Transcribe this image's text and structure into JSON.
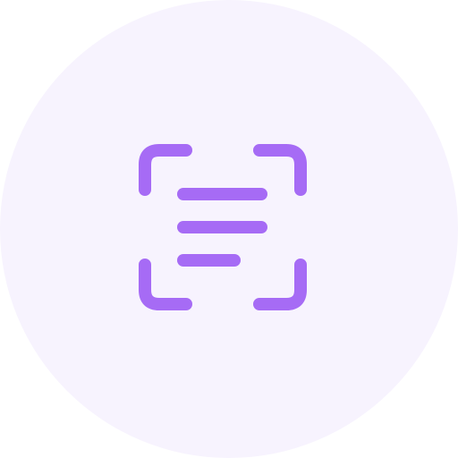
{
  "icon": {
    "name": "scan-text-icon",
    "accent_color": "#A66BF5",
    "background_color": "#F7F3FE"
  }
}
